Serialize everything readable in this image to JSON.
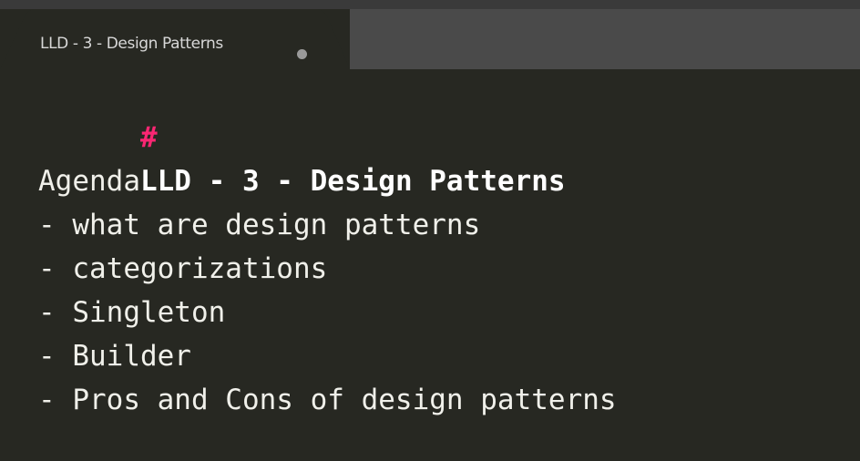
{
  "tab": {
    "title": "LLD - 3 - Design Patterns",
    "unsaved_indicator": "unsaved-dot-icon"
  },
  "editor": {
    "heading_marker": "#",
    "heading_text": "LLD - 3 - Design Patterns",
    "lines": [
      "Agenda",
      "- what are design patterns",
      "- categorizations",
      "- Singleton",
      "- Builder",
      "- Pros and Cons of design patterns"
    ]
  },
  "colors": {
    "background": "#272822",
    "tabbar": "#4a4a4a",
    "heading_marker": "#f92672",
    "text": "#f0f0ea"
  }
}
